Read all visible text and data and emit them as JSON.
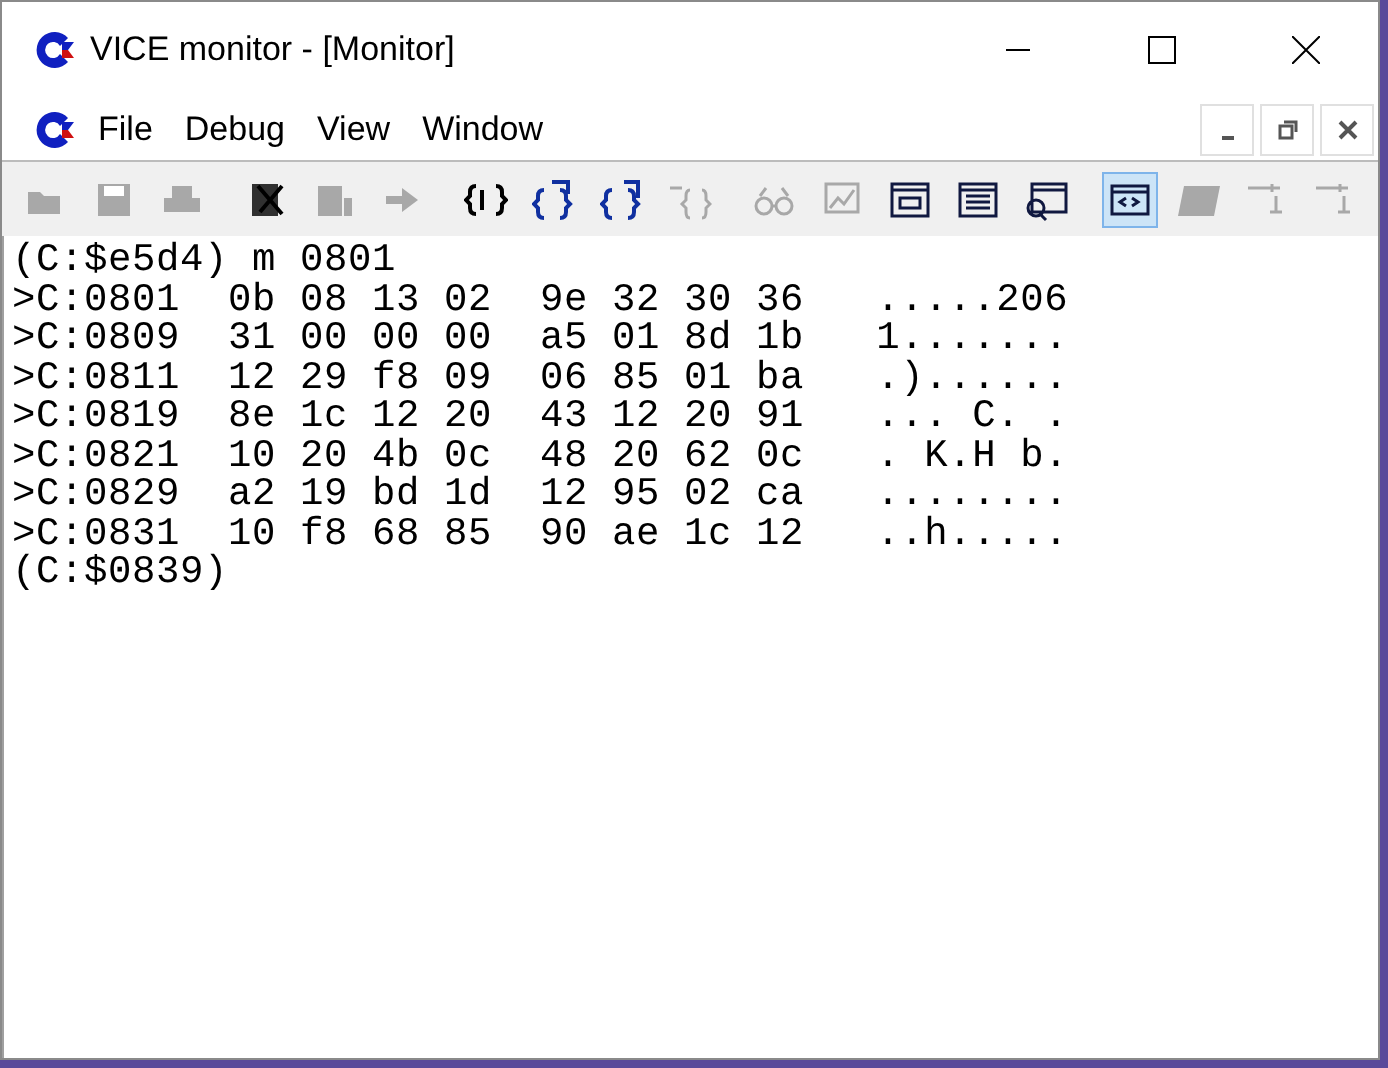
{
  "window": {
    "title": "VICE monitor - [Monitor]"
  },
  "menu": [
    "File",
    "Debug",
    "View",
    "Window"
  ],
  "toolbar": [
    {
      "disabled": true,
      "selected": false
    },
    {
      "disabled": true,
      "selected": false
    },
    {
      "disabled": true,
      "selected": false
    },
    {
      "disabled": false,
      "selected": false
    },
    {
      "disabled": true,
      "selected": false
    },
    {
      "disabled": true,
      "selected": false
    },
    {
      "disabled": false,
      "selected": false
    },
    {
      "disabled": false,
      "selected": false
    },
    {
      "disabled": false,
      "selected": false
    },
    {
      "disabled": true,
      "selected": false
    },
    {
      "disabled": true,
      "selected": false
    },
    {
      "disabled": true,
      "selected": false
    },
    {
      "disabled": false,
      "selected": false
    },
    {
      "disabled": false,
      "selected": false
    },
    {
      "disabled": false,
      "selected": false
    },
    {
      "disabled": false,
      "selected": true
    },
    {
      "disabled": true,
      "selected": false
    },
    {
      "disabled": true,
      "selected": false
    },
    {
      "disabled": true,
      "selected": false
    }
  ],
  "console_lines": [
    "(C:$e5d4) m 0801",
    ">C:0801  0b 08 13 02  9e 32 30 36   .....206",
    ">C:0809  31 00 00 00  a5 01 8d 1b   1.......",
    ">C:0811  12 29 f8 09  06 85 01 ba   .)......",
    ">C:0819  8e 1c 12 20  43 12 20 91   ... C. .",
    ">C:0821  10 20 4b 0c  48 20 62 0c   . K.H b.",
    ">C:0829  a2 19 bd 1d  12 95 02 ca   ........",
    ">C:0831  10 f8 68 85  90 ae 1c 12   ..h.....",
    "(C:$0839)"
  ]
}
